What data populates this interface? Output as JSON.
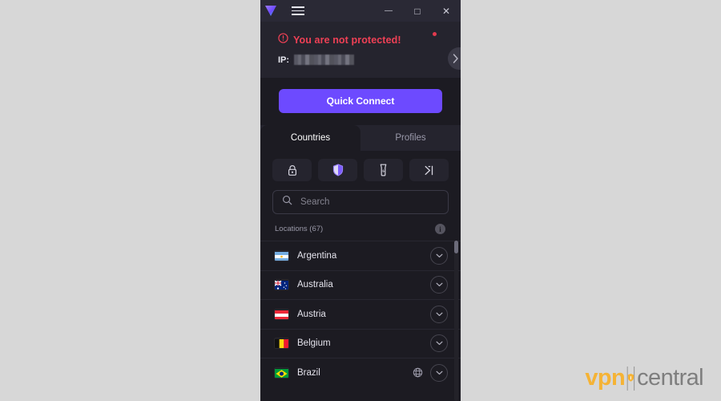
{
  "page": {
    "background_color": "#d7d7d7"
  },
  "app": {
    "window_bg": "#1c1b22",
    "accent_color": "#6d4aff",
    "logo_name": "protonvpn-logo-icon",
    "titlebar": {
      "menu_button_label": "hamburger-menu",
      "highlight_color": "#ff0000",
      "controls": [
        {
          "name": "minimize-button",
          "glyph": "—"
        },
        {
          "name": "maximize-button",
          "glyph": "□"
        },
        {
          "name": "close-button",
          "glyph": "✕"
        }
      ]
    },
    "status": {
      "text": "You are not protected!",
      "text_color": "#ef4055",
      "warning_icon": "exclamation-circle-icon",
      "ip_label": "IP:",
      "ip_value": "",
      "ip_redacted": true,
      "notification_dot_color": "#e33a4e",
      "side_panel_toggle_icon": "chevron-right-icon"
    },
    "quick_connect": {
      "label": "Quick Connect"
    },
    "tabs": [
      {
        "label": "Countries",
        "active": true,
        "name": "tab-countries"
      },
      {
        "label": "Profiles",
        "active": false,
        "name": "tab-profiles"
      }
    ],
    "toolbar": [
      {
        "name": "secure-core-icon",
        "icon": "padlock"
      },
      {
        "name": "netshield-icon",
        "icon": "shield",
        "color": "#7c5cff"
      },
      {
        "name": "kill-switch-icon",
        "icon": "bottle"
      },
      {
        "name": "port-forward-icon",
        "icon": "arrow-to-line"
      }
    ],
    "search": {
      "placeholder": "Search",
      "value": "",
      "icon": "search-icon"
    },
    "locations": {
      "label": "Locations (67)",
      "info_icon": "info-icon",
      "info_glyph": "i"
    },
    "countries": [
      {
        "name": "Argentina",
        "flag": "ar",
        "has_globe": false,
        "expand_icon": "chevron-down-icon"
      },
      {
        "name": "Australia",
        "flag": "au",
        "has_globe": false,
        "expand_icon": "chevron-down-icon"
      },
      {
        "name": "Austria",
        "flag": "at",
        "has_globe": false,
        "expand_icon": "chevron-down-icon"
      },
      {
        "name": "Belgium",
        "flag": "be",
        "has_globe": false,
        "expand_icon": "chevron-down-icon"
      },
      {
        "name": "Brazil",
        "flag": "br",
        "has_globe": true,
        "expand_icon": "chevron-down-icon",
        "globe_icon": "globe-icon"
      }
    ],
    "scrollbar": {
      "name": "country-list-scrollbar"
    }
  },
  "watermark": {
    "part1": "vpn",
    "part2": "central",
    "color1": "#f5b335",
    "color2": "#7e7e7e",
    "shield_icon": "shield-icon"
  }
}
